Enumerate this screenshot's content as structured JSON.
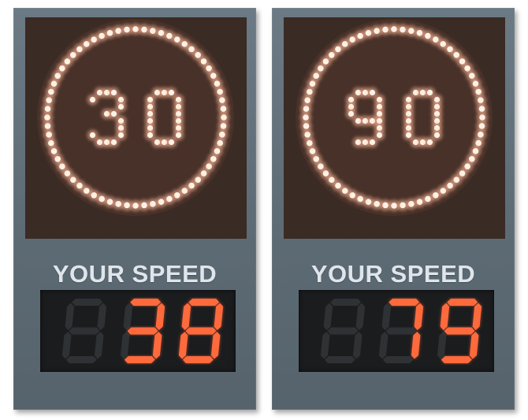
{
  "signs": [
    {
      "limit": "30",
      "caption": "YOUR SPEED",
      "speed": "38"
    },
    {
      "limit": "90",
      "caption": "YOUR SPEED",
      "speed": "79"
    }
  ],
  "colors": {
    "led_glow": "#ffb898",
    "led_core": "#fff2e6",
    "segment_on": "#ff6a3d",
    "segment_off": "#2f3235",
    "panel_bg": "#3a2b24",
    "housing": "#66747e"
  }
}
